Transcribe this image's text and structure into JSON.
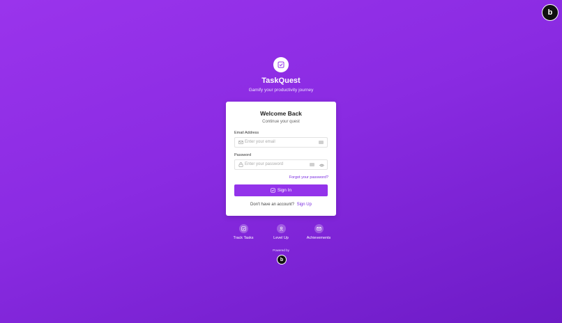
{
  "corner_badge": {
    "letter": "b"
  },
  "brand": {
    "title": "TaskQuest",
    "subtitle": "Gamify your productivity journey",
    "logo_icon": "checkbox-icon"
  },
  "card": {
    "title": "Welcome Back",
    "subtitle": "Continue your quest",
    "email": {
      "label": "Email Address",
      "placeholder": "Enter your email",
      "value": ""
    },
    "password": {
      "label": "Password",
      "placeholder": "Enter your password",
      "value": ""
    },
    "forgot_label": "Forgot your password?",
    "signin_label": "Sign In",
    "signup_prompt": "Don't have an account?",
    "signup_link": "Sign Up"
  },
  "features": [
    {
      "label": "Track Tasks",
      "icon": "checkbox-icon"
    },
    {
      "label": "Level Up",
      "icon": "user-icon"
    },
    {
      "label": "Achievements",
      "icon": "mail-icon"
    }
  ],
  "powered_by": {
    "label": "Powered by",
    "logo_letter": "b"
  },
  "colors": {
    "accent": "#9333ea",
    "link": "#7a2be0",
    "background_start": "#9a34ec",
    "background_end": "#6d1bc6"
  }
}
